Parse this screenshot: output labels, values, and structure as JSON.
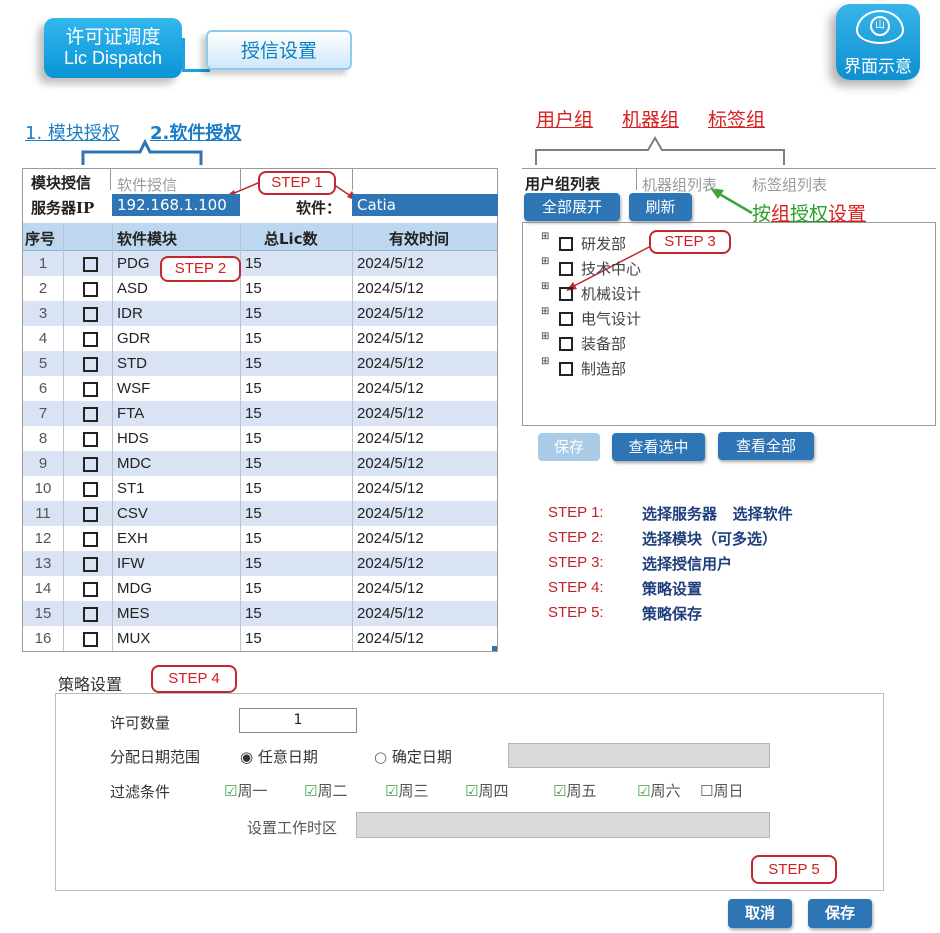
{
  "header": {
    "title_line1": "许可证调度",
    "title_line2": "Lic Dispatch",
    "subtab": "授信设置",
    "badge_label": "界面示意"
  },
  "sections": {
    "module_auth": "1. 模块授权",
    "software_auth": "2.软件授权"
  },
  "groups": {
    "user_group": "用户组",
    "machine_group": "机器组",
    "tag_group": "标签组",
    "annotation": [
      "按",
      "组",
      "授权",
      "设置"
    ]
  },
  "left": {
    "tab_active": "模块授信",
    "tab_inactive": "软件授信",
    "server_label": "服务器IP",
    "server_value": "192.168.1.100",
    "software_label": "软件：",
    "software_value": "Catia",
    "columns": [
      "序号",
      "软件模块",
      "总Lic数",
      "有效时间"
    ],
    "rows": [
      {
        "no": "1",
        "module": "PDG",
        "lic": "15",
        "date": "2024/5/12"
      },
      {
        "no": "2",
        "module": "ASD",
        "lic": "15",
        "date": "2024/5/12"
      },
      {
        "no": "3",
        "module": "IDR",
        "lic": "15",
        "date": "2024/5/12"
      },
      {
        "no": "4",
        "module": "GDR",
        "lic": "15",
        "date": "2024/5/12"
      },
      {
        "no": "5",
        "module": "STD",
        "lic": "15",
        "date": "2024/5/12"
      },
      {
        "no": "6",
        "module": "WSF",
        "lic": "15",
        "date": "2024/5/12"
      },
      {
        "no": "7",
        "module": "FTA",
        "lic": "15",
        "date": "2024/5/12"
      },
      {
        "no": "8",
        "module": "HDS",
        "lic": "15",
        "date": "2024/5/12"
      },
      {
        "no": "9",
        "module": "MDC",
        "lic": "15",
        "date": "2024/5/12"
      },
      {
        "no": "10",
        "module": "ST1",
        "lic": "15",
        "date": "2024/5/12"
      },
      {
        "no": "11",
        "module": "CSV",
        "lic": "15",
        "date": "2024/5/12"
      },
      {
        "no": "12",
        "module": "EXH",
        "lic": "15",
        "date": "2024/5/12"
      },
      {
        "no": "13",
        "module": "IFW",
        "lic": "15",
        "date": "2024/5/12"
      },
      {
        "no": "14",
        "module": "MDG",
        "lic": "15",
        "date": "2024/5/12"
      },
      {
        "no": "15",
        "module": "MES",
        "lic": "15",
        "date": "2024/5/12"
      },
      {
        "no": "16",
        "module": "MUX",
        "lic": "15",
        "date": "2024/5/12"
      }
    ]
  },
  "right": {
    "tab_user": "用户组列表",
    "tab_machine": "机器组列表",
    "tab_tag": "标签组列表",
    "expand_all": "全部展开",
    "refresh": "刷新",
    "tree": [
      "研发部",
      "技术中心",
      "机械设计",
      "电气设计",
      "装备部",
      "制造部"
    ],
    "save": "保存",
    "view_selected": "查看选中",
    "view_all": "查看全部"
  },
  "steps": {
    "step1": "STEP 1",
    "step2": "STEP 2",
    "step3": "STEP 3",
    "step4": "STEP 4",
    "step5": "STEP 5",
    "list": [
      {
        "key": "STEP 1:",
        "desc": "选择服务器   选择软件"
      },
      {
        "key": "STEP 2:",
        "desc": "选择模块（可多选）"
      },
      {
        "key": "STEP 3:",
        "desc": "选择授信用户"
      },
      {
        "key": "STEP 4:",
        "desc": "策略设置"
      },
      {
        "key": "STEP 5:",
        "desc": "策略保存"
      }
    ]
  },
  "strategy": {
    "title": "策略设置",
    "qty_label": "许可数量",
    "qty_value": "1",
    "date_label": "分配日期范围",
    "date_any": "任意日期",
    "date_fixed": "确定日期",
    "filter_label": "过滤条件",
    "days": [
      "周一",
      "周二",
      "周三",
      "周四",
      "周五",
      "周六",
      "周日"
    ],
    "days_checked": [
      true,
      true,
      true,
      true,
      true,
      true,
      false
    ],
    "worktime_label": "设置工作时区",
    "cancel": "取消",
    "save": "保存"
  },
  "colors": {
    "accent_blue": "#2e75b6",
    "step_red": "#c0282e",
    "header_row": "#bdd7ee",
    "stripe": "#dae3f3"
  }
}
